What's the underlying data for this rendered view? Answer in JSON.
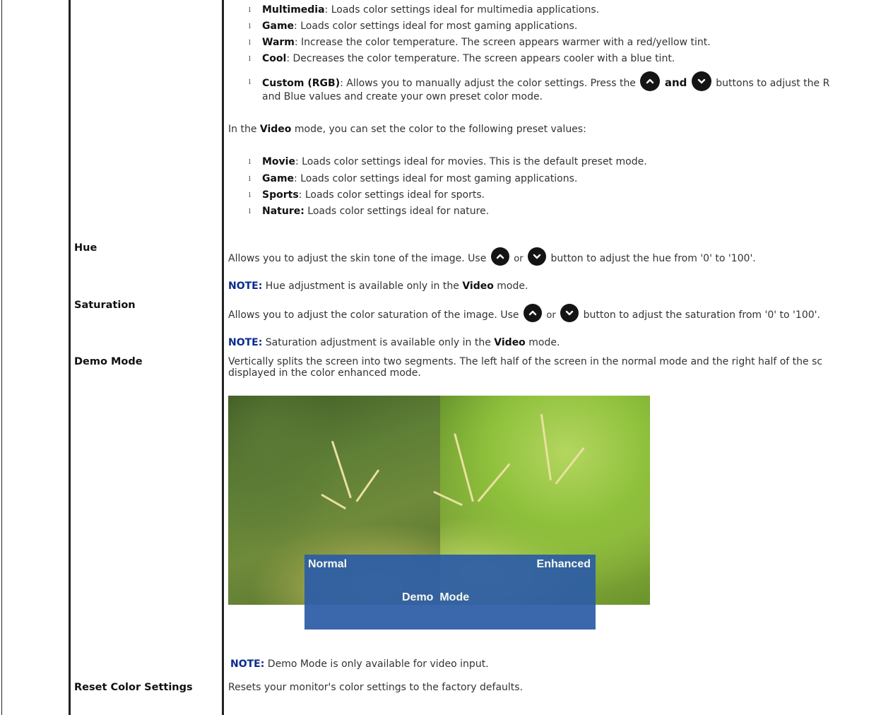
{
  "color_mode_items": [
    {
      "term": "Multimedia",
      "text": ": Loads color settings ideal for multimedia applications."
    },
    {
      "term": "Game",
      "text": ": Loads color settings ideal for most gaming applications."
    },
    {
      "term": "Warm",
      "text": ": Increase the color temperature. The screen appears warmer with a red/yellow tint."
    },
    {
      "term": "Cool",
      "text": ": Decreases the color temperature. The screen appears cooler with a blue tint."
    }
  ],
  "custom": {
    "term": "Custom (RGB)",
    "text_before": ": Allows you to manually adjust the color settings. Press the",
    "and": "and",
    "text_after": "buttons to adjust the R",
    "line2": "and Blue values and create your own preset color mode."
  },
  "video_intro": {
    "before": "In the ",
    "bold": "Video",
    "after": " mode, you can set the color to the following preset values:"
  },
  "video_items": [
    {
      "term": "Movie",
      "text": ": Loads color settings ideal for movies. This is the default preset mode."
    },
    {
      "term": "Game",
      "text": ": Loads color settings ideal for most gaming applications."
    },
    {
      "term": "Sports",
      "text": ": Loads color settings ideal for sports."
    },
    {
      "term": "Nature:",
      "text": " Loads color settings ideal for nature."
    }
  ],
  "hue": {
    "label": "Hue",
    "desc_before": "Allows you to adjust the skin tone of the image. Use",
    "or": "or",
    "desc_after": "button to adjust the hue from '0' to '100'.",
    "note_label": "NOTE:",
    "note_before": " Hue adjustment is available only in the ",
    "note_bold": "Video",
    "note_after": " mode."
  },
  "saturation": {
    "label": "Saturation",
    "desc_before": "Allows you to adjust the color saturation of the image. Use",
    "or": "or",
    "desc_after": "button to adjust the saturation from '0' to '100'.",
    "note_label": "NOTE:",
    "note_before": " Saturation adjustment is available only in the ",
    "note_bold": "Video",
    "note_after": " mode."
  },
  "demo_mode": {
    "label": "Demo Mode",
    "desc_line1": "Vertically splits the screen into two segments. The left half of the screen in the normal mode and the right half of the sc",
    "desc_line2": "displayed in the color enhanced mode.",
    "image_normal": "Normal",
    "image_enhanced": "Enhanced",
    "image_title": "Demo  Mode",
    "note_label": "NOTE:",
    "note_text": " Demo Mode is only available for video input."
  },
  "reset": {
    "label": "Reset Color Settings",
    "desc": "Resets your monitor's color settings to the factory defaults."
  },
  "icons": {
    "up": "chevron-up-button-icon",
    "down": "chevron-down-button-icon"
  },
  "colors": {
    "note": "#0b2b8c",
    "banner": "#2d5da6",
    "text": "#333333"
  }
}
